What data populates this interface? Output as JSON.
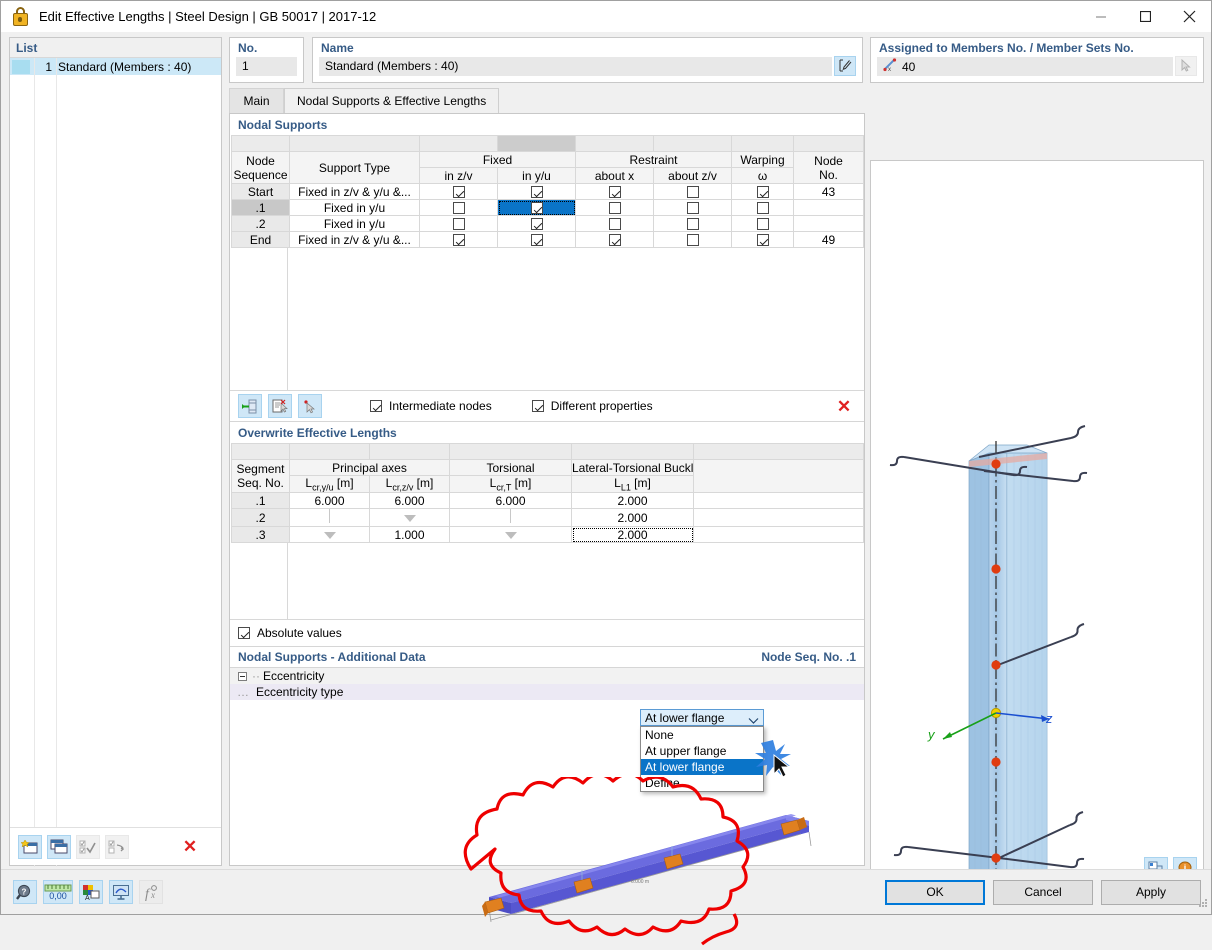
{
  "window": {
    "title": "Edit Effective Lengths | Steel Design | GB 50017 | 2017-12",
    "icon": "lock-icon",
    "minimize_label": "—",
    "maximize_label": "□",
    "close_label": "✕"
  },
  "list_panel": {
    "header": "List",
    "rows": [
      {
        "number": "1",
        "label": "Standard (Members : 40)"
      }
    ],
    "toolbar": [
      {
        "name": "new-item-button",
        "icon": "new-window-icon"
      },
      {
        "name": "copy-item-button",
        "icon": "copy-window-icon"
      },
      {
        "name": "select-all-button",
        "icon": "check-all-icon"
      },
      {
        "name": "invert-selection-button",
        "icon": "invert-check-icon"
      },
      {
        "name": "delete-item-button",
        "icon": "red-x-icon",
        "glyph": "✕"
      }
    ]
  },
  "fields": {
    "no_label": "No.",
    "no_value": "1",
    "name_label": "Name",
    "name_value": "Standard (Members : 40)",
    "name_edit_icon": "edit-pencil-icon",
    "assigned_label": "Assigned to Members No. / Member Sets No.",
    "assigned_value": "40",
    "assigned_icon": "member-select-icon",
    "assigned_pick_icon": "pick-cursor-icon"
  },
  "tabs": [
    {
      "label": "Main",
      "active": false
    },
    {
      "label": "Nodal Supports & Effective Lengths",
      "active": true
    }
  ],
  "nodal_supports": {
    "title": "Nodal Supports",
    "group_headers": [
      {
        "label": "Fixed",
        "span": 2
      },
      {
        "label": "Restraint",
        "span": 2
      },
      {
        "label": "Warping",
        "span": 1
      }
    ],
    "columns": [
      "Node Sequence",
      "Support Type",
      "in z/v",
      "in y/u",
      "about x",
      "about z/v",
      "ω",
      "Node No."
    ],
    "column_top_labels": {
      "node_sequence_line1": "Node",
      "node_sequence_line2": "Sequence",
      "support_type": "Support Type",
      "node_no_line1": "Node",
      "node_no_line2": "No."
    },
    "rows": [
      {
        "seq": "Start",
        "support_type": "Fixed in z/v & y/u &...",
        "fixed_z": true,
        "fixed_y": true,
        "restraint_x": true,
        "restraint_z": false,
        "warping": true,
        "node_no": "43",
        "selected": false,
        "cell_selected": false
      },
      {
        "seq": ".1",
        "support_type": "Fixed in y/u",
        "fixed_z": false,
        "fixed_y": true,
        "restraint_x": false,
        "restraint_z": false,
        "warping": false,
        "node_no": "",
        "selected": true,
        "cell_selected": true
      },
      {
        "seq": ".2",
        "support_type": "Fixed in y/u",
        "fixed_z": false,
        "fixed_y": true,
        "restraint_x": false,
        "restraint_z": false,
        "warping": false,
        "node_no": "",
        "selected": false,
        "cell_selected": false
      },
      {
        "seq": "End",
        "support_type": "Fixed in z/v & y/u &...",
        "fixed_z": true,
        "fixed_y": true,
        "restraint_x": true,
        "restraint_z": false,
        "warping": true,
        "node_no": "49",
        "selected": false,
        "cell_selected": false
      }
    ],
    "toolbar": [
      {
        "name": "insert-node-button",
        "icon": "insert-node-icon"
      },
      {
        "name": "edit-support-button",
        "icon": "edit-support-icon"
      },
      {
        "name": "pick-node-button",
        "icon": "pick-node-icon"
      }
    ],
    "checkboxes": [
      {
        "label": "Intermediate nodes",
        "checked": true
      },
      {
        "label": "Different properties",
        "checked": true
      }
    ],
    "delete_button": {
      "name": "delete-row-button",
      "glyph": "✕"
    }
  },
  "effective_lengths": {
    "title": "Overwrite Effective Lengths",
    "group_headers": [
      {
        "label": "Principal axes",
        "span": 2
      },
      {
        "label": "Torsional",
        "span": 1
      },
      {
        "label": "Lateral-Torsional Buckli",
        "span": 1
      }
    ],
    "row_header_line1": "Segment",
    "row_header_line2": "Seq. No.",
    "columns": [
      "Lcr,y/u [m]",
      "Lcr,z/v [m]",
      "Lcr,T [m]",
      "LL1 [m]"
    ],
    "column_parts": [
      {
        "base": "L",
        "sub": "cr,y/u",
        "unit": " [m]"
      },
      {
        "base": "L",
        "sub": "cr,z/v",
        "unit": " [m]"
      },
      {
        "base": "L",
        "sub": "cr,T",
        "unit": " [m]"
      },
      {
        "base": "L",
        "sub": "L1",
        "unit": " [m]"
      }
    ],
    "rows": [
      {
        "seq": ".1",
        "lcr_yu": "6.000",
        "lcr_zv": "6.000",
        "lcr_t": "6.000",
        "l_l1": "2.000",
        "marks": [
          "",
          "",
          "",
          ""
        ]
      },
      {
        "seq": ".2",
        "lcr_yu": "",
        "lcr_zv": "",
        "lcr_t": "",
        "l_l1": "2.000",
        "marks": [
          "line",
          "arrow",
          "line",
          ""
        ]
      },
      {
        "seq": ".3",
        "lcr_yu": "",
        "lcr_zv": "1.000",
        "lcr_t": "",
        "l_l1": "2.000",
        "marks": [
          "arrow",
          "",
          "arrow",
          ""
        ]
      }
    ],
    "absolute_values": {
      "label": "Absolute values",
      "checked": true
    }
  },
  "additional_data": {
    "title": "Nodal Supports - Additional Data",
    "node_seq": "Node Seq. No. .1",
    "group_label": "Eccentricity",
    "property_label": "Eccentricity type",
    "value": "At lower flange",
    "dropdown_open": true,
    "options": [
      {
        "label": "None",
        "selected": false
      },
      {
        "label": "At upper flange",
        "selected": false
      },
      {
        "label": "At lower flange",
        "selected": true
      },
      {
        "label": "Define...",
        "selected": false
      }
    ]
  },
  "view_panel": {
    "axes": [
      {
        "label": "y",
        "color": "#18a018"
      },
      {
        "label": "z",
        "color": "#1a4fd0"
      }
    ],
    "tools": [
      {
        "name": "view-rotate-button",
        "icon": "rotate-view-icon"
      },
      {
        "name": "view-info-button",
        "icon": "info-balloon-icon"
      }
    ]
  },
  "status_toolbar": [
    {
      "name": "help-button",
      "icon": "help-magnifier-icon"
    },
    {
      "name": "units-button",
      "icon": "units-icon",
      "glyph": "0,00"
    },
    {
      "name": "display-properties-button",
      "icon": "display-props-icon"
    },
    {
      "name": "visual-settings-button",
      "icon": "visual-settings-icon"
    },
    {
      "name": "formula-button",
      "icon": "formula-icon",
      "glyph": "f"
    }
  ],
  "dialog_buttons": [
    {
      "label": "OK",
      "default": true,
      "name": "ok-button"
    },
    {
      "label": "Cancel",
      "default": false,
      "name": "cancel-button"
    },
    {
      "label": "Apply",
      "default": false,
      "name": "apply-button"
    }
  ],
  "colors": {
    "accent_blue": "#0a74c8",
    "section_title": "#365b86",
    "selection_row": "#cce8f7",
    "annotation_red": "#ee0000",
    "beam_blue": "#5b5bdc",
    "support_orange": "#e08020"
  }
}
